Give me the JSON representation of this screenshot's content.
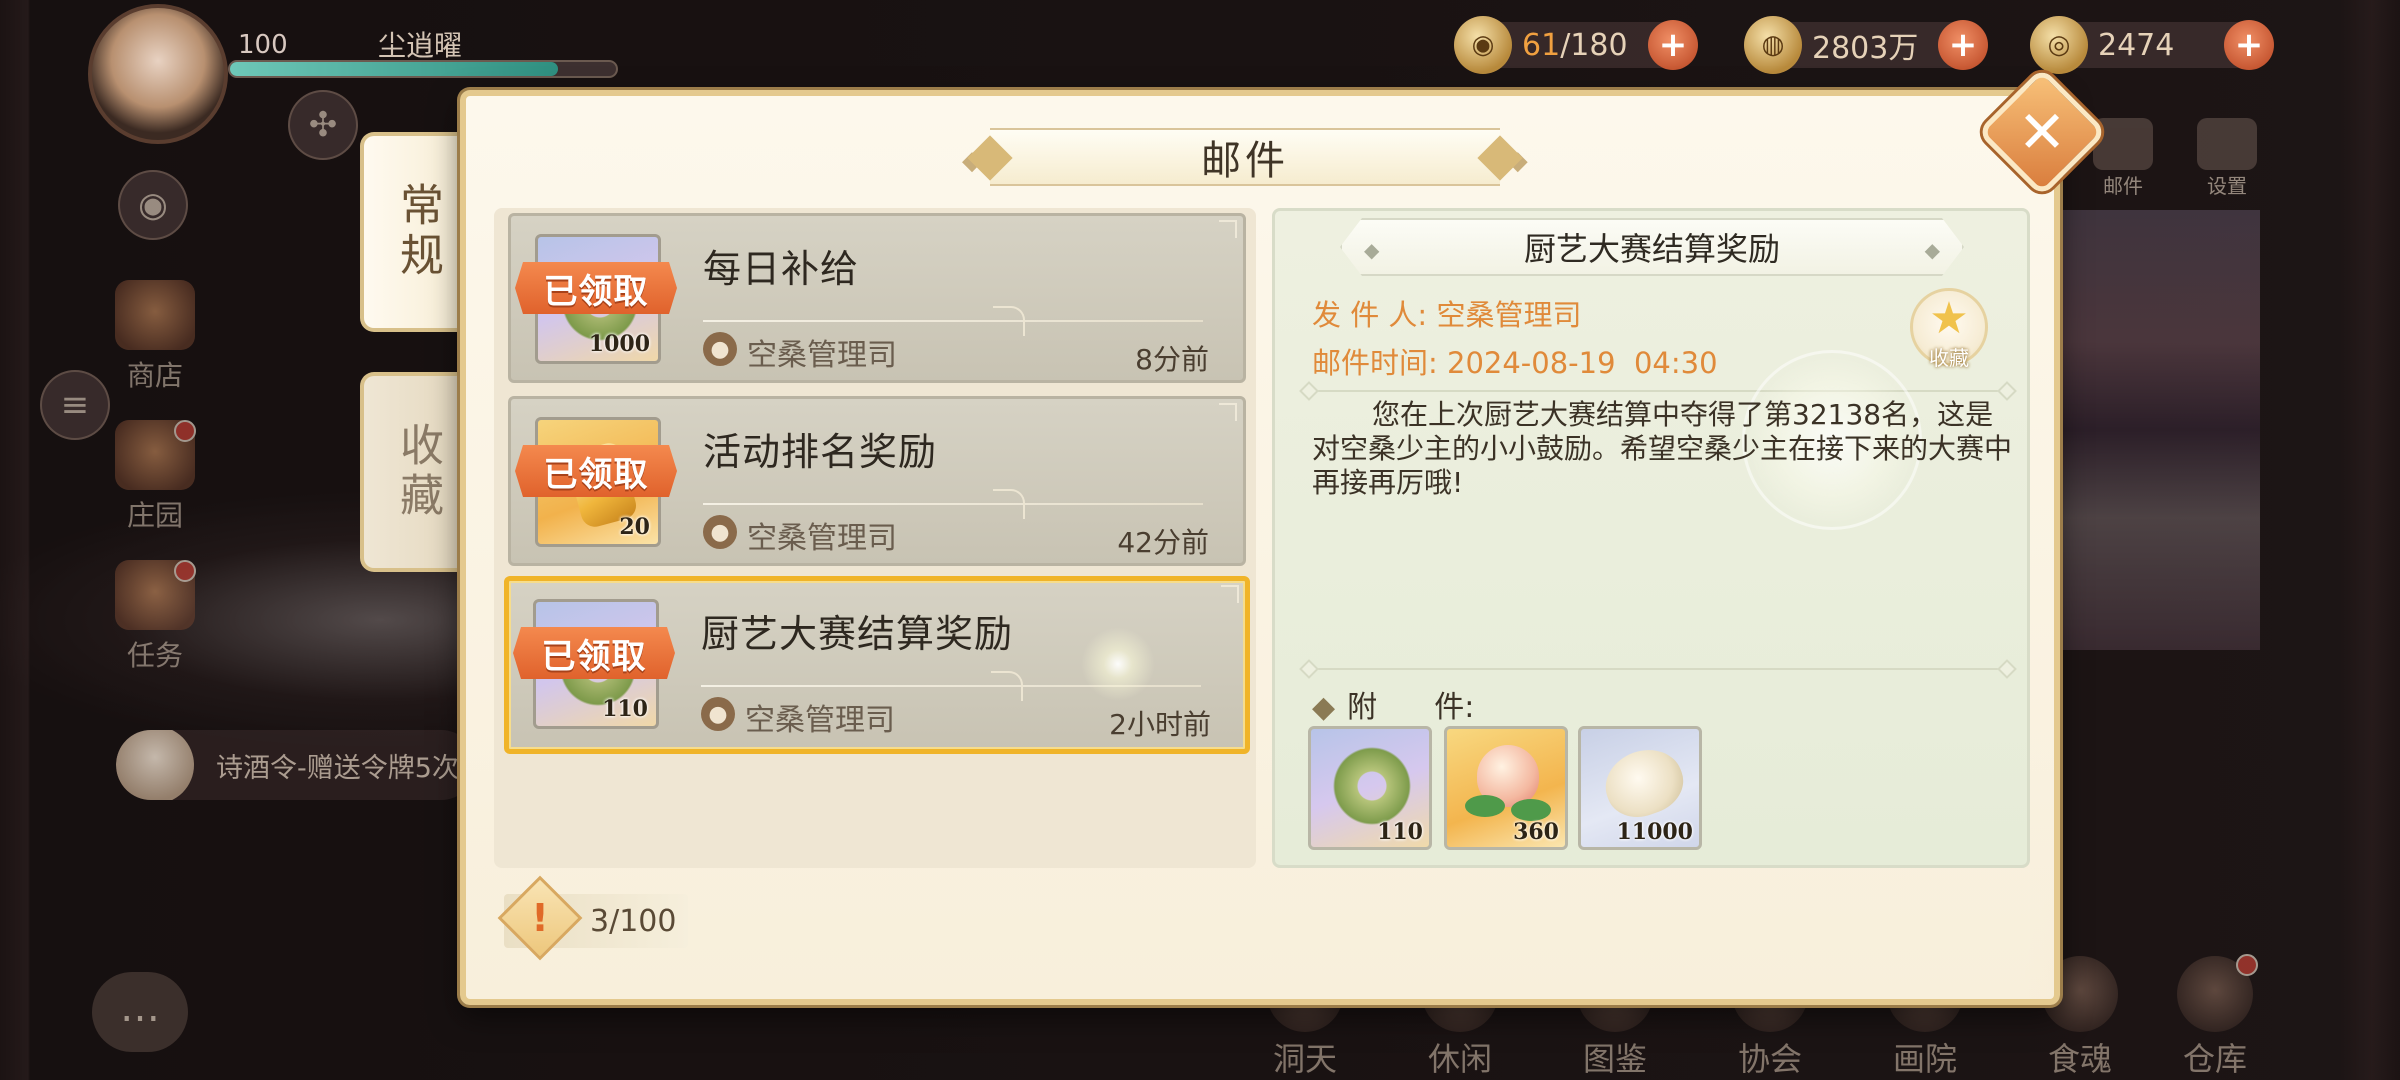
{
  "hud": {
    "level": "100",
    "player_name": "尘逍曜",
    "xp_progress": 0.85,
    "stamina_current": "61",
    "stamina_max": "/180",
    "copper": "2803万",
    "jade": "2474",
    "plus": "+"
  },
  "side_menu": [
    "商店",
    "庄园",
    "任务"
  ],
  "ticker": "诗酒令-赠送令牌5次",
  "right_top": [
    "邮件",
    "设置"
  ],
  "bottom_nav": [
    "洞天",
    "休闲",
    "图鉴",
    "协会",
    "画院",
    "食魂",
    "仓库"
  ],
  "mail_panel": {
    "title": "邮件",
    "tabs": [
      {
        "label": "常规",
        "active": true
      },
      {
        "label": "收藏",
        "active": false
      }
    ],
    "close": "✕",
    "claimed_label": "已领取",
    "items": [
      {
        "subject": "每日补给",
        "sender": "空桑管理司",
        "time": "8分前",
        "reward_qty": "1000",
        "selected": false
      },
      {
        "subject": "活动排名奖励",
        "sender": "空桑管理司",
        "time": "42分前",
        "reward_qty": "20",
        "selected": false
      },
      {
        "subject": "厨艺大赛结算奖励",
        "sender": "空桑管理司",
        "time": "2小时前",
        "reward_qty": "110",
        "selected": true
      }
    ],
    "capacity": "3/100",
    "capacity_icon": "!"
  },
  "detail": {
    "title": "厨艺大赛结算奖励",
    "sender_label": "发 件 人:",
    "sender": "空桑管理司",
    "time_label": "邮件时间:",
    "time": "2024-08-19  04:30",
    "favorite_label": "收藏",
    "body": "您在上次厨艺大赛结算中夺得了第32138名，这是对空桑少主的小小鼓励。希望空桑少主在接下来的大赛中再接再厉哦!",
    "attachments_label": "附      件:",
    "attachments": [
      {
        "name": "jade-ring",
        "qty": "110"
      },
      {
        "name": "peach",
        "qty": "360"
      },
      {
        "name": "shell",
        "qty": "11000"
      }
    ]
  },
  "colors": {
    "accent_orange": "#e0622c",
    "selected_border": "#f0b429",
    "meta_text": "#e08a3a"
  }
}
